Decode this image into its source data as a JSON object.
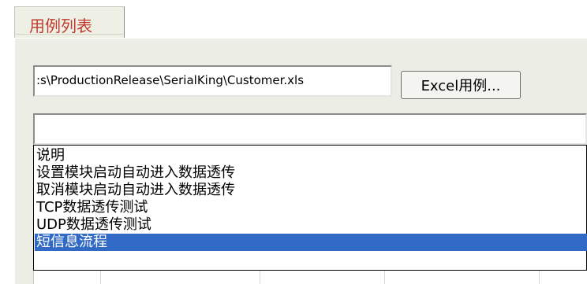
{
  "tab": {
    "label": "用例列表"
  },
  "excel": {
    "path_value": ":s\\ProductionRelease\\SerialKing\\Customer.xls",
    "button_label": "Excel用例..."
  },
  "combo": {
    "value": ""
  },
  "list": {
    "items": [
      {
        "label": "说明",
        "selected": false
      },
      {
        "label": "设置模块启动自动进入数据透传",
        "selected": false
      },
      {
        "label": "取消模块启动自动进入数据透传",
        "selected": false
      },
      {
        "label": "TCP数据透传测试",
        "selected": false
      },
      {
        "label": "UDP数据透传测试",
        "selected": false
      },
      {
        "label": "短信息流程",
        "selected": true
      }
    ]
  },
  "colors": {
    "selection": "#316ac5",
    "tab_text": "#c0392b"
  }
}
